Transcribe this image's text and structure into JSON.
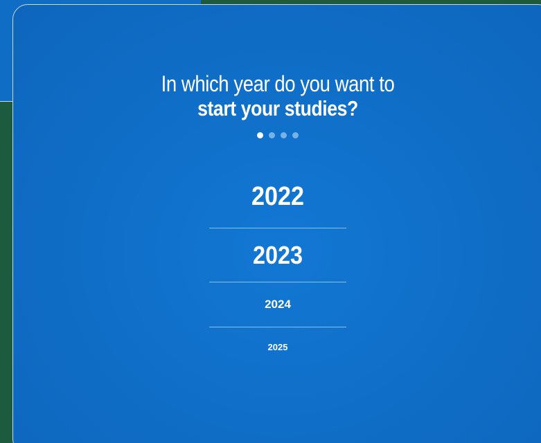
{
  "question": {
    "line1": "In which year do you want to",
    "line2": "start your studies?"
  },
  "progress": {
    "total_steps": 4,
    "current_step": 1
  },
  "years": [
    {
      "label": "2022"
    },
    {
      "label": "2023"
    },
    {
      "label": "2024"
    },
    {
      "label": "2025"
    }
  ],
  "colors": {
    "background_green": "#1d5b3e",
    "modal_blue": "#0f6dc6",
    "text": "#ffffff"
  }
}
